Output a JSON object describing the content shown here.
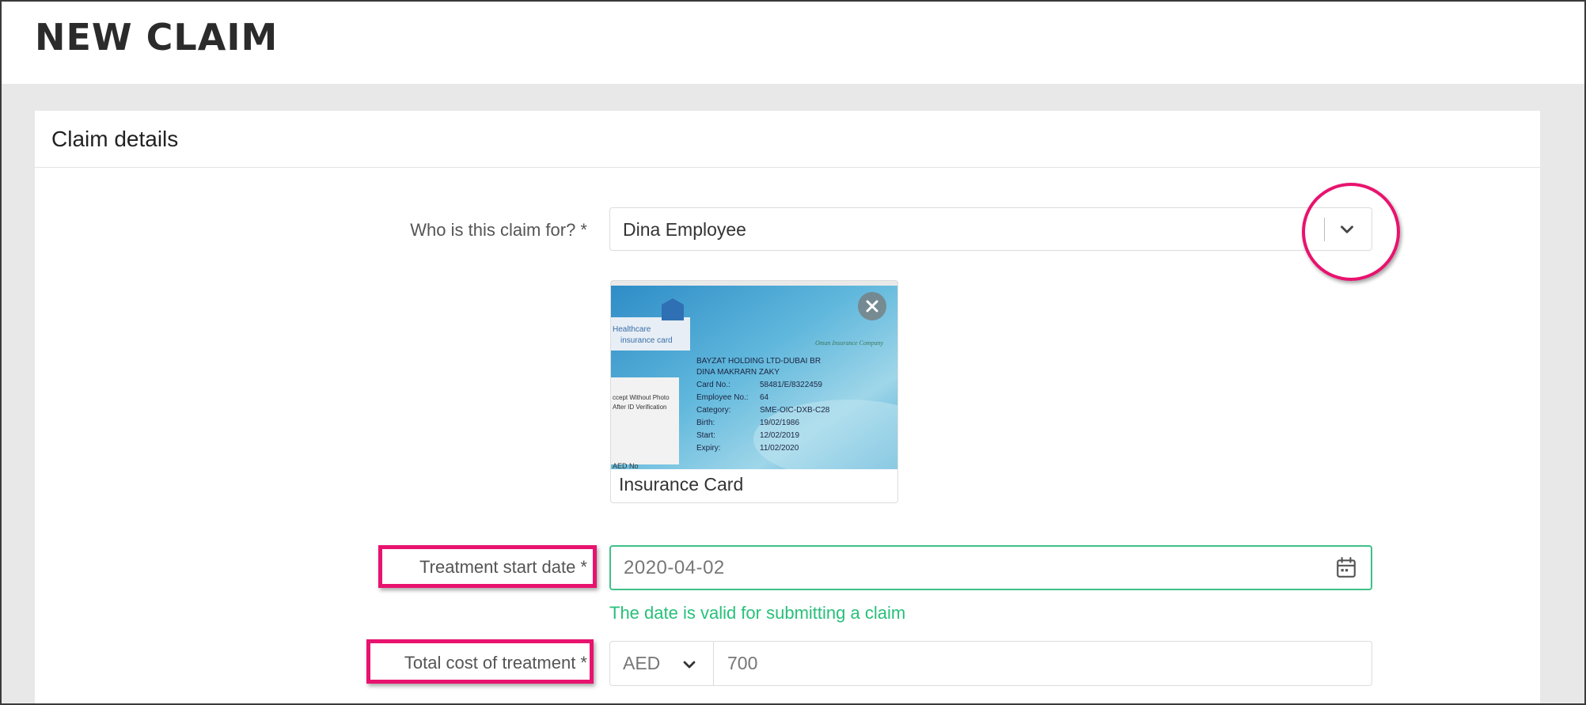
{
  "page": {
    "title": "NEW CLAIM"
  },
  "card": {
    "title": "Claim details"
  },
  "claim_for": {
    "label": "Who is this claim for? *",
    "value": "Dina Employee"
  },
  "attachment": {
    "caption": "Insurance Card",
    "card_text": {
      "title_line1": "Healthcare",
      "title_line2": "insurance card",
      "company": "BAYZAT HOLDING LTD-DUBAI BR",
      "member": "DINA MAKRARN ZAKY",
      "insurer": "Oman Insurance Company",
      "notes": [
        "ccept Without Photo",
        "After ID Verification"
      ],
      "fields": [
        {
          "k": "Card No.:",
          "v": "58481/E/8322459"
        },
        {
          "k": "Employee No.:",
          "v": "64"
        },
        {
          "k": "Category:",
          "v": "SME-OIC-DXB-C28"
        },
        {
          "k": "Birth:",
          "v": "19/02/1986"
        },
        {
          "k": "Start:",
          "v": "12/02/2019"
        },
        {
          "k": "Expiry:",
          "v": "11/02/2020"
        }
      ],
      "footer": "AED No"
    }
  },
  "treatment_date": {
    "label": "Treatment start date *",
    "value": "2020-04-02",
    "valid_message": "The date is valid for submitting a claim"
  },
  "total_cost": {
    "label": "Total cost of treatment *",
    "currency": "AED",
    "amount": "700"
  },
  "colors": {
    "highlight": "#e8136e",
    "valid_green": "#27c07a",
    "border": "#dcdcdc"
  }
}
